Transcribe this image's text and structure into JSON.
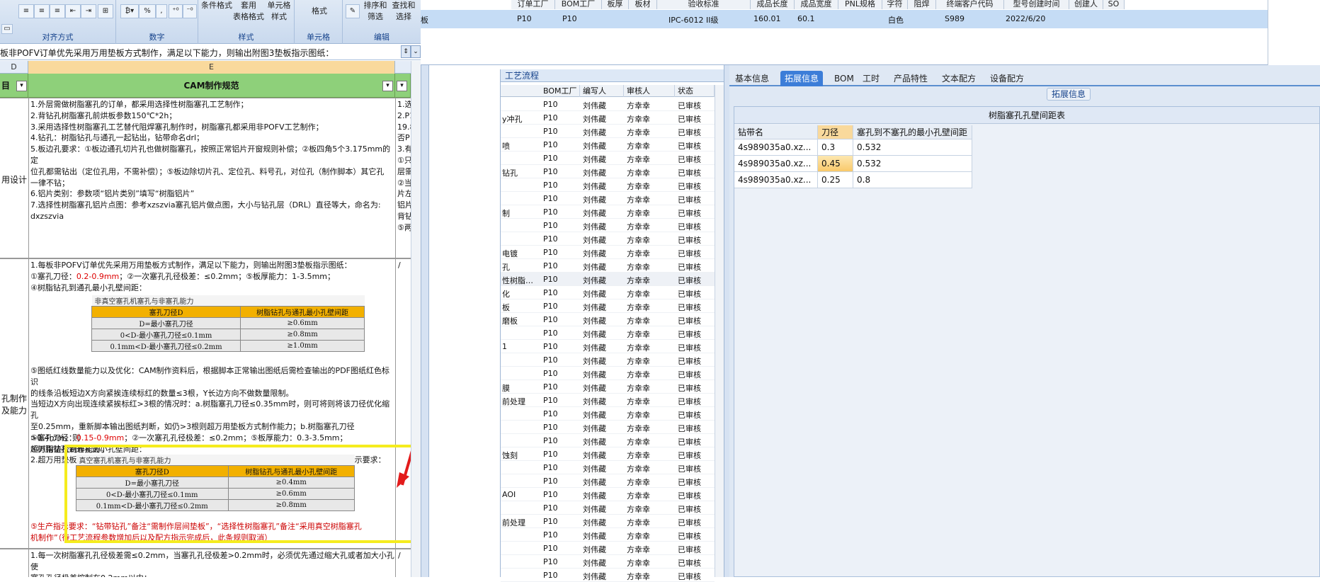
{
  "ribbon": {
    "groups": [
      {
        "caption": "对齐方式"
      },
      {
        "caption": "数字"
      },
      {
        "caption": "样式"
      },
      {
        "caption": "单元格"
      },
      {
        "caption": "编辑"
      }
    ],
    "style_buttons": [
      "条件格式",
      "套用\n表格格式",
      "单元格\n样式"
    ],
    "cell_button": "格式",
    "edit_buttons": [
      "排序和\n筛选",
      "查找和\n选择"
    ],
    "number_symbols": [
      "%",
      ","
    ]
  },
  "formula_bar": {
    "text": "板非POFV订单优先采用万用垫板方式制作，满足以下能力，则输出附图3垫板指示图纸："
  },
  "sheet": {
    "column_letters": [
      "D",
      "E"
    ],
    "header": {
      "col_d": "目",
      "col_e": "CAM制作规范"
    },
    "row1_label": "用设计",
    "row1_text": "1.外层需做树脂塞孔的订单，都采用选择性树脂塞孔工艺制作；\n2.背钻孔树脂塞孔前烘板参数150℃*2h；\n3.采用选择性树脂塞孔工艺替代阻焊塞孔制作时，树脂塞孔都采用非POFV工艺制作；\n4.钻孔：树脂钻孔与通孔一起钻出，钻带命名drl；\n5.板边孔要求：①板边通孔切片孔也做树脂塞孔，按照正常铝片开窗规则补偿；②板四角5个3.175mm的定\n位孔都需钻出（定位孔用，不需补偿）；⑤板边除切片孔、定位孔、料号孔，对位孔（制作脚本）其它孔\n一律不钻；\n6.铝片类别：参数项“铝片类别”填写“树脂铝片”\n7.选择性树脂塞孔铝片点图：参考xzszvia塞孔铝片做点图，大小与钻孔层（DRL）直径等大，命名为:\ndxzszvia",
    "row1_right": "1.选\n2.P1\n19.8\n否P\n3.有\n①只\n层需\n②当\n片左\n铝片\n背钻\n⑤两",
    "row2_label_a": "孔制作",
    "row2_label_b": "及能力",
    "row2_right": "/",
    "row2_p1a": "1.每板非POFV订单优先采用万用垫板方式制作，满足以下能力，则输出附图3垫板指示图纸：",
    "row2_p1b_pre": "①塞孔刀径：",
    "row2_p1b_red": "0.2-0.9mm",
    "row2_p1b_post": "；②一次塞孔孔径极差：≤0.2mm；⑤板厚能力：1-3.5mm；",
    "row2_p1c": "④树脂钻孔到通孔最小孔壁间距：",
    "table1": {
      "caption": "非真空塞孔机塞孔与非塞孔能力",
      "headers": [
        "塞孔刀径D",
        "树脂钻孔与通孔最小孔壁间距"
      ],
      "rows": [
        [
          "D=最小塞孔刀径",
          "≥0.6mm"
        ],
        [
          "0<D-最小塞孔刀径≤0.1mm",
          "≥0.8mm"
        ],
        [
          "0.1mm<D-最小塞孔刀径≤0.2mm",
          "≥1.0mm"
        ]
      ]
    },
    "row2_p2": "⑤图纸红线数量能力以及优化：CAM制作资料后，根据脚本正常输出图纸后需检查输出的PDF图纸红色标识\n的线条沿板短边X方向紧挨连续标红的数量≤3根，Y长边方向不做数量限制。\n当短边X方向出现连续紧挨标红>3根的情况时：a.树脂塞孔刀径≤0.35mm时，则可将则将该刀径优化缩孔\n至0.25mm，重新脚本输出图纸判断，如仍>3根则超万用垫板方式制作能力；b.树脂塞孔刀径>0.4mm，则\n超万用垫板制作能力。\n2.超万用垫板方式制作能力以及POFV产品采用专用垫板方式制作，满足以下能力则输出生产指示要求：",
    "row2_p3_pre": "①塞孔刀径：",
    "row2_p3_red": "0.15-0.9mm",
    "row2_p3_post": "；②一次塞孔孔径极差：≤0.2mm；⑤板厚能力：0.3-3.5mm；",
    "row2_p4": "④树脂钻孔到通孔最小孔壁间距：",
    "table2": {
      "caption": "真空塞孔机塞孔与非塞孔能力",
      "headers": [
        "塞孔刀径D",
        "树脂钻孔与通孔最小孔壁间距"
      ],
      "rows": [
        [
          "D=最小塞孔刀径",
          "≥0.4mm"
        ],
        [
          "0<D-最小塞孔刀径≤0.1mm",
          "≥0.6mm"
        ],
        [
          "0.1mm<D-最小塞孔刀径≤0.2mm",
          "≥0.8mm"
        ]
      ]
    },
    "row2_p5": "⑤生产指示要求：“钻带钻孔”备注“需制作层间垫板”，“选择性树脂塞孔”备注“采用真空树脂塞孔\n机制作”（待工艺流程参数增加后以及配方指示完成后，此条规则取消）",
    "row3_text": "1.每一次树脂塞孔孔径极差需≤0.2mm，当塞孔孔径极差>0.2mm时，必须优先通过缩大孔或者加大小孔使\n塞孔孔径极差控制在0.2mm以内；\n2.树脂钻孔与通孔孔壁间距不足的订单，优先通过缩孔满足能力；",
    "row3_right": "/"
  },
  "top_grid": {
    "headers": [
      "订单工厂",
      "BOM工厂",
      "板厚",
      "板材",
      "验收标准",
      "成品长度",
      "成品宽度",
      "PNL规格",
      "字符",
      "阻焊",
      "终端客户代码",
      "型号创建时间",
      "创建人",
      "SO"
    ],
    "row": {
      "factory": "P10",
      "bom_factory": "P10",
      "standard": "IPC-6012 II级",
      "length": "160.01",
      "width": "60.1",
      "char_color": "白色",
      "customer": "S989",
      "created": "2022/6/20",
      "prefix": "板"
    }
  },
  "process_pane": {
    "tab": "工艺流程",
    "columns": [
      "BOM工厂",
      "编写人",
      "审核人",
      "状态"
    ],
    "rows": [
      {
        "name": "",
        "bom": "P10",
        "writer": "刘伟藏",
        "reviewer": "方幸幸",
        "status": "已审核"
      },
      {
        "name": "y冲孔",
        "bom": "P10",
        "writer": "刘伟藏",
        "reviewer": "方幸幸",
        "status": "已审核"
      },
      {
        "name": "",
        "bom": "P10",
        "writer": "刘伟藏",
        "reviewer": "方幸幸",
        "status": "已审核"
      },
      {
        "name": "喷",
        "bom": "P10",
        "writer": "刘伟藏",
        "reviewer": "方幸幸",
        "status": "已审核"
      },
      {
        "name": "",
        "bom": "P10",
        "writer": "刘伟藏",
        "reviewer": "方幸幸",
        "status": "已审核"
      },
      {
        "name": "钻孔",
        "bom": "P10",
        "writer": "刘伟藏",
        "reviewer": "方幸幸",
        "status": "已审核"
      },
      {
        "name": "",
        "bom": "P10",
        "writer": "刘伟藏",
        "reviewer": "方幸幸",
        "status": "已审核"
      },
      {
        "name": "",
        "bom": "P10",
        "writer": "刘伟藏",
        "reviewer": "方幸幸",
        "status": "已审核"
      },
      {
        "name": "制",
        "bom": "P10",
        "writer": "刘伟藏",
        "reviewer": "方幸幸",
        "status": "已审核"
      },
      {
        "name": "",
        "bom": "P10",
        "writer": "刘伟藏",
        "reviewer": "方幸幸",
        "status": "已审核"
      },
      {
        "name": "",
        "bom": "P10",
        "writer": "刘伟藏",
        "reviewer": "方幸幸",
        "status": "已审核"
      },
      {
        "name": "电镀",
        "bom": "P10",
        "writer": "刘伟藏",
        "reviewer": "方幸幸",
        "status": "已审核"
      },
      {
        "name": "孔",
        "bom": "P10",
        "writer": "刘伟藏",
        "reviewer": "方幸幸",
        "status": "已审核"
      },
      {
        "name": "性树脂…",
        "bom": "P10",
        "writer": "刘伟藏",
        "reviewer": "方幸幸",
        "status": "已审核"
      },
      {
        "name": "化",
        "bom": "P10",
        "writer": "刘伟藏",
        "reviewer": "方幸幸",
        "status": "已审核"
      },
      {
        "name": "板",
        "bom": "P10",
        "writer": "刘伟藏",
        "reviewer": "方幸幸",
        "status": "已审核"
      },
      {
        "name": "磨板",
        "bom": "P10",
        "writer": "刘伟藏",
        "reviewer": "方幸幸",
        "status": "已审核"
      },
      {
        "name": "",
        "bom": "P10",
        "writer": "刘伟藏",
        "reviewer": "方幸幸",
        "status": "已审核"
      },
      {
        "name": "1",
        "bom": "P10",
        "writer": "刘伟藏",
        "reviewer": "方幸幸",
        "status": "已审核"
      },
      {
        "name": "",
        "bom": "P10",
        "writer": "刘伟藏",
        "reviewer": "方幸幸",
        "status": "已审核"
      },
      {
        "name": "",
        "bom": "P10",
        "writer": "刘伟藏",
        "reviewer": "方幸幸",
        "status": "已审核"
      },
      {
        "name": "膜",
        "bom": "P10",
        "writer": "刘伟藏",
        "reviewer": "方幸幸",
        "status": "已审核"
      },
      {
        "name": "前处理",
        "bom": "P10",
        "writer": "刘伟藏",
        "reviewer": "方幸幸",
        "status": "已审核"
      },
      {
        "name": "",
        "bom": "P10",
        "writer": "刘伟藏",
        "reviewer": "方幸幸",
        "status": "已审核"
      },
      {
        "name": "",
        "bom": "P10",
        "writer": "刘伟藏",
        "reviewer": "方幸幸",
        "status": "已审核"
      },
      {
        "name": "",
        "bom": "P10",
        "writer": "刘伟藏",
        "reviewer": "方幸幸",
        "status": "已审核"
      },
      {
        "name": "蚀刻",
        "bom": "P10",
        "writer": "刘伟藏",
        "reviewer": "方幸幸",
        "status": "已审核"
      },
      {
        "name": "",
        "bom": "P10",
        "writer": "刘伟藏",
        "reviewer": "方幸幸",
        "status": "已审核"
      },
      {
        "name": "",
        "bom": "P10",
        "writer": "刘伟藏",
        "reviewer": "方幸幸",
        "status": "已审核"
      },
      {
        "name": "AOI",
        "bom": "P10",
        "writer": "刘伟藏",
        "reviewer": "方幸幸",
        "status": "已审核"
      },
      {
        "name": "",
        "bom": "P10",
        "writer": "刘伟藏",
        "reviewer": "方幸幸",
        "status": "已审核"
      },
      {
        "name": "前处理",
        "bom": "P10",
        "writer": "刘伟藏",
        "reviewer": "方幸幸",
        "status": "已审核"
      },
      {
        "name": "",
        "bom": "P10",
        "writer": "刘伟藏",
        "reviewer": "方幸幸",
        "status": "已审核"
      },
      {
        "name": "",
        "bom": "P10",
        "writer": "刘伟藏",
        "reviewer": "方幸幸",
        "status": "已审核"
      },
      {
        "name": "",
        "bom": "P10",
        "writer": "刘伟藏",
        "reviewer": "方幸幸",
        "status": "已审核"
      },
      {
        "name": "",
        "bom": "P10",
        "writer": "刘伟藏",
        "reviewer": "方幸幸",
        "status": "已审核"
      }
    ]
  },
  "right_pane": {
    "tabs": [
      "基本信息",
      "拓展信息",
      "BOM",
      "工时",
      "产品特性",
      "文本配方",
      "设备配方"
    ],
    "active_tab": "拓展信息",
    "group_caption": "拓展信息",
    "table_title": "树脂塞孔孔壁间距表",
    "columns": [
      "钻带名",
      "刀径",
      "塞孔到不塞孔的最小孔壁间距"
    ],
    "rows": [
      [
        "4s989035a0.xz...",
        "0.3",
        "0.532"
      ],
      [
        "4s989035a0.xz...",
        "0.45",
        "0.532"
      ],
      [
        "4s989035a0.xz...",
        "0.25",
        "0.8"
      ]
    ]
  },
  "colors": {
    "accent": "#3c7dd8",
    "header_green": "#8ed07a",
    "table_yellow": "#f2b000",
    "highlight_box": "#f5ec1e",
    "arrow": "#e31b1b"
  }
}
